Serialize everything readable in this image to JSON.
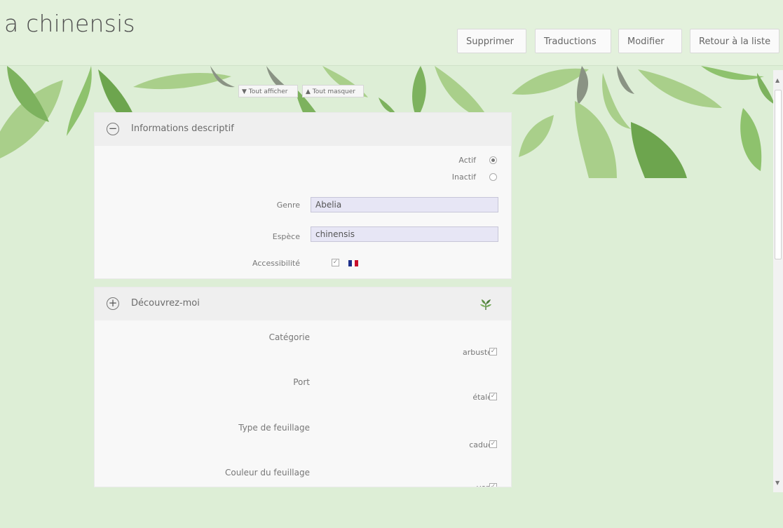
{
  "header": {
    "title": "a chinensis",
    "buttons": {
      "delete": "Supprimer",
      "translations": "Traductions",
      "edit": "Modifier",
      "back": "Retour à la liste"
    }
  },
  "toggles": {
    "show_all": "▼ Tout afficher",
    "hide_all": "▲ Tout masquer"
  },
  "panel_info": {
    "title": "Informations descriptif",
    "status_active": "Actif",
    "status_inactive": "Inactif",
    "status_selected": "Actif",
    "genus_label": "Genre",
    "genus_value": "Abelia",
    "species_label": "Espèce",
    "species_value": "chinensis",
    "accessibility_label": "Accessibilité",
    "accessibility_checked": true
  },
  "panel_discover": {
    "title": "Découvrez-moi",
    "rows": [
      {
        "label": "Catégorie",
        "value": "arbuste"
      },
      {
        "label": "Port",
        "value": "étalé"
      },
      {
        "label": "Type de feuillage",
        "value": "caduc"
      },
      {
        "label": "Couleur du feuillage",
        "value": "vert"
      }
    ]
  },
  "colors": {
    "background": "#ddeed6",
    "leaf_light": "#a9cf8a",
    "leaf_mid": "#7db25e",
    "leaf_grey": "#8a9384",
    "field_bg": "#e7e6f5",
    "flag_blue": "#1d2f8a",
    "flag_red": "#c8102e"
  },
  "icons": [
    "minus-circle-icon",
    "plus-circle-icon",
    "plant-icon",
    "checkbox-icon",
    "french-flag-icon"
  ]
}
